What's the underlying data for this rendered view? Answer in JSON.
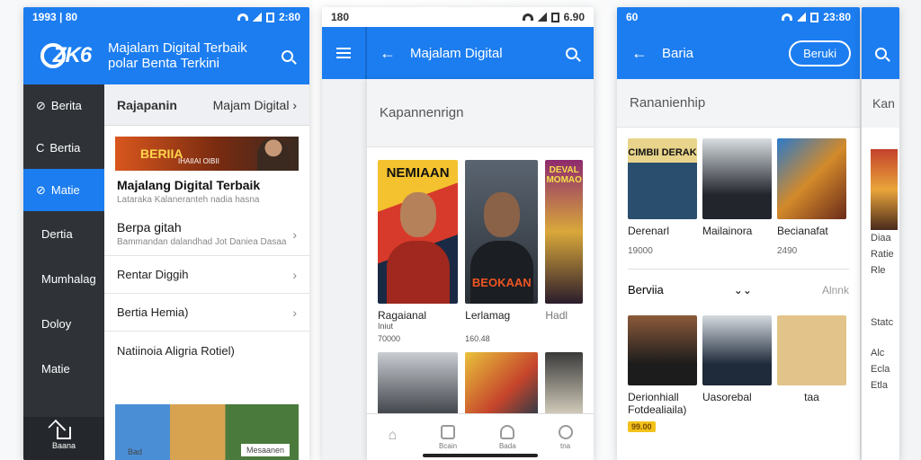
{
  "colors": {
    "accent": "#1c7df0",
    "sidebar": "#2f3338",
    "gold": "#f2c21a"
  },
  "screen1": {
    "status_time": "1993 | 80",
    "status_right": "2:80",
    "logo_text": "ZK6",
    "brand_line1": "Majalam Digital Terbaik",
    "brand_line2": "polar Benta Terkini",
    "sidebar": [
      {
        "label": "Berita",
        "icon": "check-circle-icon"
      },
      {
        "label": "Bertia",
        "icon": "circle-icon"
      },
      {
        "label": "Matie",
        "icon": "link-icon"
      },
      {
        "label": "Dertia"
      },
      {
        "label": "Mumhalag"
      },
      {
        "label": "Doloy"
      },
      {
        "label": "Matie"
      }
    ],
    "sidebar_bottom_label": "Baana",
    "tab_left": "Rajapanin",
    "tab_right": "Majam Digital",
    "banner_title": "BERIIA",
    "banner_sub": "IHAIIAI OIBII",
    "feature_title": "Majalang Digital Terbaik",
    "feature_desc": "Lataraka Kalaneranteh nadia hasna",
    "entries": [
      {
        "title": "Berpa gitah",
        "desc": "Bammandan dalandhad Jot Daniea Dasaa"
      },
      {
        "title": "Rentar Diggih"
      },
      {
        "title": "Bertia Hemia)"
      },
      {
        "title": "Natiinoia Aligria Rotiel)"
      }
    ],
    "bottom_tabs": [
      "Bad",
      "Mesaanen"
    ]
  },
  "screen2": {
    "status_time": "180",
    "status_right": "6.90",
    "title": "Majalam Digital",
    "section": "Kapannenrign",
    "covers": [
      {
        "title": "NEMIAAN",
        "bottom": ""
      },
      {
        "title": "",
        "bottom": "BEOKAAN"
      },
      {
        "title": "DEVAL MOMAO",
        "bottom": ""
      }
    ],
    "captions": [
      {
        "title": "Ragaianal",
        "num": "70000"
      },
      {
        "title": "Lerlamag",
        "num": "160.48"
      },
      {
        "title": "Hadl",
        "num": ""
      }
    ],
    "caption_sub": "Iniut",
    "nav": [
      "",
      "Bcain",
      "Bada",
      "tna"
    ]
  },
  "screen3": {
    "status_time": "60",
    "status_right": "23:80",
    "title": "Baria",
    "pill": "Beruki",
    "section": "Rananienhip",
    "tiles_top": [
      {
        "text": "CIMBII DERAK",
        "color": "#2a4e6e"
      },
      {
        "text": "",
        "color": "#c9cfd6"
      },
      {
        "text": "",
        "color": "#d38a2a"
      }
    ],
    "captions_top": [
      {
        "title": "Derenarl",
        "num": "19000"
      },
      {
        "title": "Mailainora",
        "num": ""
      },
      {
        "title": "Becianafat",
        "num": "2490"
      }
    ],
    "section2_title": "Berviia",
    "section2_more": "Alnnk",
    "captions_bottom": [
      {
        "title": "Derionhiall Fotdealiaila)",
        "price": "99.00"
      },
      {
        "title": "Uasorebal",
        "price": ""
      },
      {
        "title": "taa",
        "price": ""
      }
    ]
  },
  "screen4": {
    "head": "Kan",
    "lines": [
      "Diaa",
      "Ratie",
      "Rle",
      "Statc",
      "Alc",
      "Ecla",
      "Etla"
    ]
  }
}
